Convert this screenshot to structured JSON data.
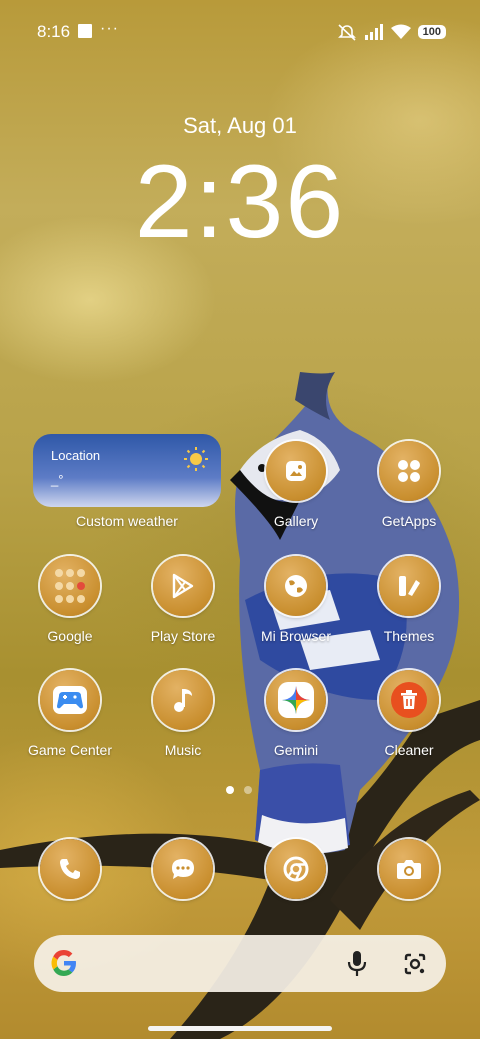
{
  "status_bar": {
    "time": "8:16",
    "more": "···",
    "battery": "100",
    "icons": [
      "notification-icon",
      "mute-icon",
      "signal-icon",
      "wifi-icon"
    ]
  },
  "lockscreen": {
    "date": "Sat, Aug 01",
    "time": "2:36"
  },
  "weather_widget": {
    "title": "Location",
    "value": "_°",
    "label": "Custom weather",
    "icon": "sun-icon"
  },
  "apps": [
    {
      "id": "gallery",
      "label": "Gallery",
      "icon": "gallery-icon"
    },
    {
      "id": "getapps",
      "label": "GetApps",
      "icon": "getapps-icon"
    },
    {
      "id": "google",
      "label": "Google",
      "icon": "google-folder-icon"
    },
    {
      "id": "playstore",
      "label": "Play Store",
      "icon": "play-store-icon"
    },
    {
      "id": "mibrowser",
      "label": "Mi Browser",
      "icon": "globe-icon"
    },
    {
      "id": "themes",
      "label": "Themes",
      "icon": "themes-icon"
    },
    {
      "id": "gamecenter",
      "label": "Game Center",
      "icon": "gamepad-icon"
    },
    {
      "id": "music",
      "label": "Music",
      "icon": "music-note-icon"
    },
    {
      "id": "gemini",
      "label": "Gemini",
      "icon": "gemini-icon"
    },
    {
      "id": "cleaner",
      "label": "Cleaner",
      "icon": "trash-icon"
    }
  ],
  "dock": [
    {
      "id": "phone",
      "icon": "phone-icon"
    },
    {
      "id": "messages",
      "icon": "messages-icon"
    },
    {
      "id": "chrome",
      "icon": "chrome-icon"
    },
    {
      "id": "camera",
      "icon": "camera-icon"
    }
  ],
  "pager": {
    "pages": 2,
    "current": 1
  },
  "search_bar": {
    "icons": [
      "google-g-icon",
      "microphone-icon",
      "google-lens-icon"
    ]
  },
  "colors": {
    "accent": "#c98f2f",
    "widget": "#2f58a8",
    "cleaner": "#e8501f"
  }
}
